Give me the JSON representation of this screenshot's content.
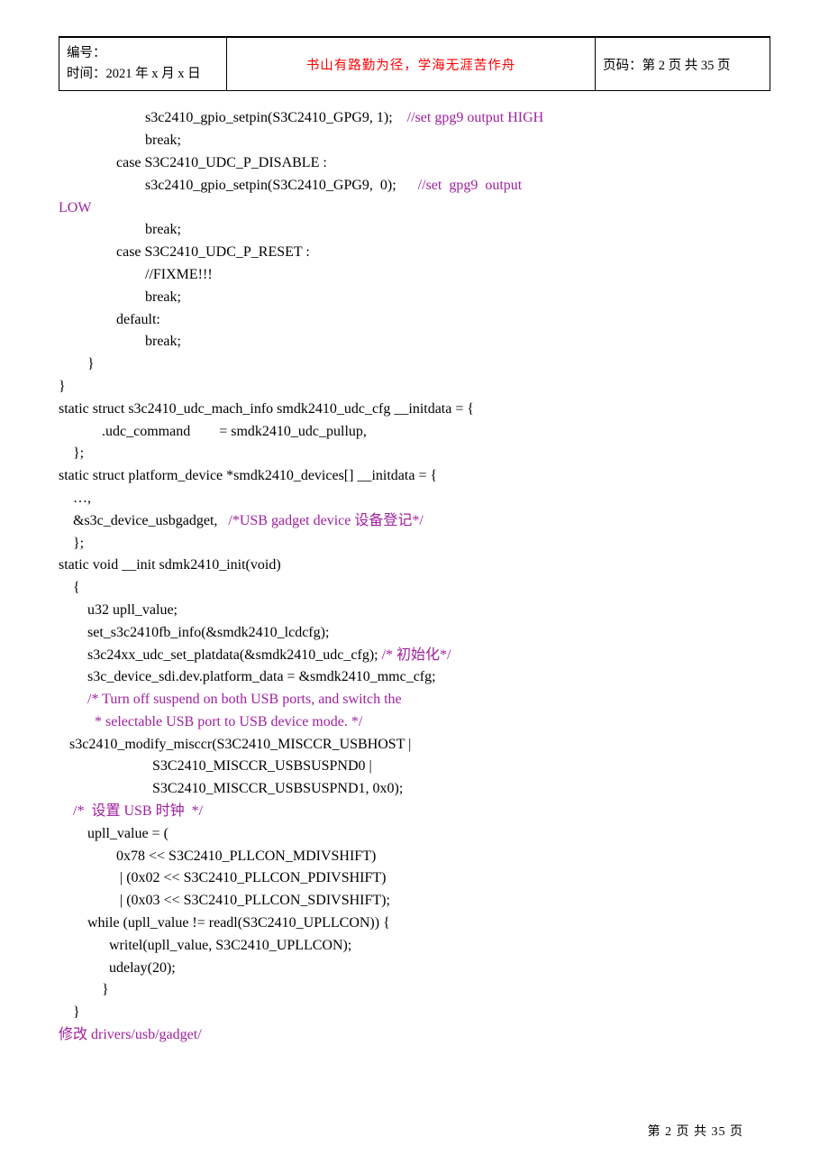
{
  "header": {
    "left_line1": "编号：",
    "left_line2": "时间：2021 年 x 月 x 日",
    "center": "书山有路勤为径，学海无涯苦作舟",
    "right": "页码：第 2 页 共 35 页"
  },
  "code": {
    "l1_a": "                        s3c2410_gpio_setpin(S3C2410_GPG9, 1);    ",
    "l1_b": "//set gpg9 output HIGH",
    "l2": "                        break;",
    "l3": "                case S3C2410_UDC_P_DISABLE :",
    "l4_a": "                        s3c2410_gpio_setpin(S3C2410_GPG9,  0);      ",
    "l4_b": "//set  gpg9  output",
    "l5": "LOW",
    "l6": "                        break;",
    "l7": "                case S3C2410_UDC_P_RESET :",
    "l8": "                        //FIXME!!!",
    "l9": "                        break;",
    "l10": "                default:",
    "l11": "                        break;",
    "l12": "        }",
    "l13": "}",
    "l14": "static struct s3c2410_udc_mach_info smdk2410_udc_cfg __initdata = {",
    "l15": "            .udc_command        = smdk2410_udc_pullup,",
    "l16": "    };",
    "l17": "static struct platform_device *smdk2410_devices[] __initdata = {",
    "l18": "    …,",
    "l19_a": "    &s3c_device_usbgadget,   ",
    "l19_b": "/*USB gadget device 设备登记*/",
    "l20": "    };",
    "l21": "static void __init sdmk2410_init(void)",
    "l22": "    {",
    "l23": "        u32 upll_value;",
    "l24": "        set_s3c2410fb_info(&smdk2410_lcdcfg);",
    "l25_a": "        s3c24xx_udc_set_platdata(&smdk2410_udc_cfg); ",
    "l25_b": "/* 初始化*/",
    "l26": "        s3c_device_sdi.dev.platform_data = &smdk2410_mmc_cfg;",
    "l27": "        /* Turn off suspend on both USB ports, and switch the",
    "l28": "          * selectable USB port to USB device mode. */",
    "l29": "   s3c2410_modify_misccr(S3C2410_MISCCR_USBHOST |",
    "l30": "                          S3C2410_MISCCR_USBSUSPND0 |",
    "l31": "                          S3C2410_MISCCR_USBSUSPND1, 0x0);",
    "l32": "    /*  设置 USB 时钟  */",
    "l33": "        upll_value = (",
    "l34": "                0x78 << S3C2410_PLLCON_MDIVSHIFT)",
    "l35": "                 | (0x02 << S3C2410_PLLCON_PDIVSHIFT)",
    "l36": "                 | (0x03 << S3C2410_PLLCON_SDIVSHIFT);",
    "l37": "        while (upll_value != readl(S3C2410_UPLLCON)) {",
    "l38": "              writel(upll_value, S3C2410_UPLLCON);",
    "l39": "              udelay(20);",
    "l40": "            }",
    "l41": "    }",
    "l42": "修改 drivers/usb/gadget/"
  },
  "footer": "第 2 页 共 35 页"
}
